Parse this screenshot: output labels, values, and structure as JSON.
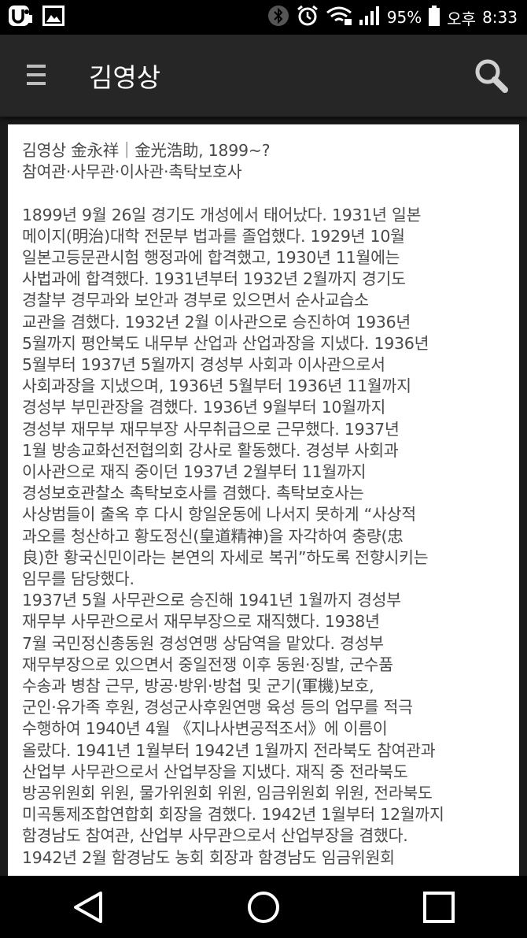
{
  "status_bar": {
    "battery": "95%",
    "ampm": "오후",
    "time": "8:33",
    "icons": [
      "app-notification-icon",
      "gallery-icon",
      "bluetooth-icon",
      "alarm-icon",
      "wifi-icon",
      "signal-icon",
      "battery-icon"
    ]
  },
  "app_bar": {
    "title": "김영상",
    "menu_icon": "hamburger-menu-icon",
    "search_icon": "search-icon"
  },
  "article": {
    "header": [
      "김영상 金永祥｜金光浩助, 1899~?",
      "참여관·사무관·이사관·촉탁보호사"
    ],
    "body_lines": [
      "1899년 9월 26일 경기도 개성에서 태어났다. 1931년 일본",
      "메이지(明治)대학 전문부 법과를 졸업했다. 1929년 10월",
      "일본고등문관시험 행정과에 합격했고, 1930년 11월에는",
      "사법과에 합격했다. 1931년부터 1932년 2월까지 경기도",
      "경찰부 경무과와 보안과 경부로 있으면서 순사교습소",
      "교관을 겸했다. 1932년 2월 이사관으로 승진하여 1936년",
      "5월까지 평안북도 내무부 산업과 산업과장을 지냈다. 1936년",
      "5월부터 1937년 5월까지 경성부 사회과 이사관으로서",
      "사회과장을 지냈으며, 1936년 5월부터 1936년 11월까지",
      "경성부 부민관장을 겸했다. 1936년 9월부터 10월까지",
      "경성부 재무부 재무부장 사무취급으로 근무했다. 1937년",
      "1월 방송교화선전협의회 강사로 활동했다. 경성부 사회과",
      "이사관으로 재직 중이던 1937년 2월부터 11월까지",
      "경성보호관찰소 촉탁보호사를 겸했다. 촉탁보호사는",
      "사상범들이 출옥 후 다시 항일운동에 나서지 못하게 “사상적",
      "과오를 청산하고 황도정신(皇道精神)을 자각하여 충량(忠",
      "良)한 황국신민이라는 본연의 자세로 복귀”하도록 전향시키는",
      "임무를 담당했다.",
      "1937년 5월 사무관으로 승진해 1941년 1월까지 경성부",
      "재무부 사무관으로서 재무부장으로 재직했다. 1938년",
      "7월 국민정신총동원 경성연맹 상담역을 맡았다. 경성부",
      "재무부장으로 있으면서 중일전쟁 이후 동원·징발, 군수품",
      "수송과 병참 근무, 방공·방위·방첩 및 군기(軍機)보호,",
      "군인·유가족 후원, 경성군사후원연맹 육성 등의 업무를 적극",
      "수행하여 1940년 4월 《지나사변공적조서》에 이름이",
      "올랐다. 1941년 1월부터 1942년 1월까지 전라북도 참여관과",
      "산업부 사무관으로서 산업부장을 지냈다. 재직 중 전라북도",
      "방공위원회 위원, 물가위원회 위원, 임금위원회 위원, 전라북도",
      "미곡통제조합연합회 회장을 겸했다. 1942년 1월부터 12월까지",
      "함경남도 참여관, 산업부 사무관으로서 산업부장을 겸했다.",
      "1942년 2월 함경남도 농회 회장과 함경남도 임금위원회"
    ]
  },
  "nav_bar": {
    "icons": [
      "back-icon",
      "home-icon",
      "recents-icon"
    ]
  }
}
